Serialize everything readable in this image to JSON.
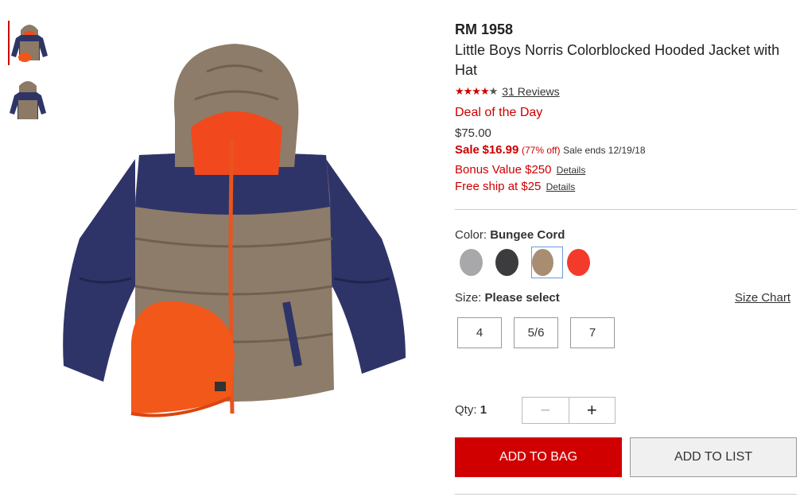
{
  "product": {
    "brand": "RM 1958",
    "title": "Little Boys Norris Colorblocked Hooded Jacket with Hat",
    "rating": {
      "stars": 4.5,
      "reviews_label": "31 Reviews"
    },
    "deal_label": "Deal of the Day",
    "original_price": "$75.00",
    "sale_prefix": "Sale",
    "sale_price": "$16.99",
    "percent_off": "(77% off)",
    "sale_ends": "Sale ends 12/19/18",
    "bonus_text": "Bonus Value $250",
    "free_ship_text": "Free ship at $25",
    "details_label": "Details"
  },
  "color": {
    "label": "Color:",
    "selected": "Bungee Cord",
    "swatches": [
      {
        "name": "gray",
        "hex": "#a8a8aa"
      },
      {
        "name": "charcoal",
        "hex": "#3c3c3e"
      },
      {
        "name": "bungee-cord",
        "hex": "#a88d72"
      },
      {
        "name": "orange-red",
        "hex": "#f43b2b"
      }
    ]
  },
  "size": {
    "label": "Size:",
    "selected": "Please select",
    "chart_label": "Size Chart",
    "options": [
      "4",
      "5/6",
      "7"
    ]
  },
  "quantity": {
    "label": "Qty:",
    "value": "1",
    "decrement": "−",
    "increment": "+"
  },
  "actions": {
    "add_to_bag": "ADD TO BAG",
    "add_to_list": "ADD TO LIST"
  },
  "colors": {
    "accent": "#d10000",
    "swatch_selected_border": "#6a9bd8"
  }
}
